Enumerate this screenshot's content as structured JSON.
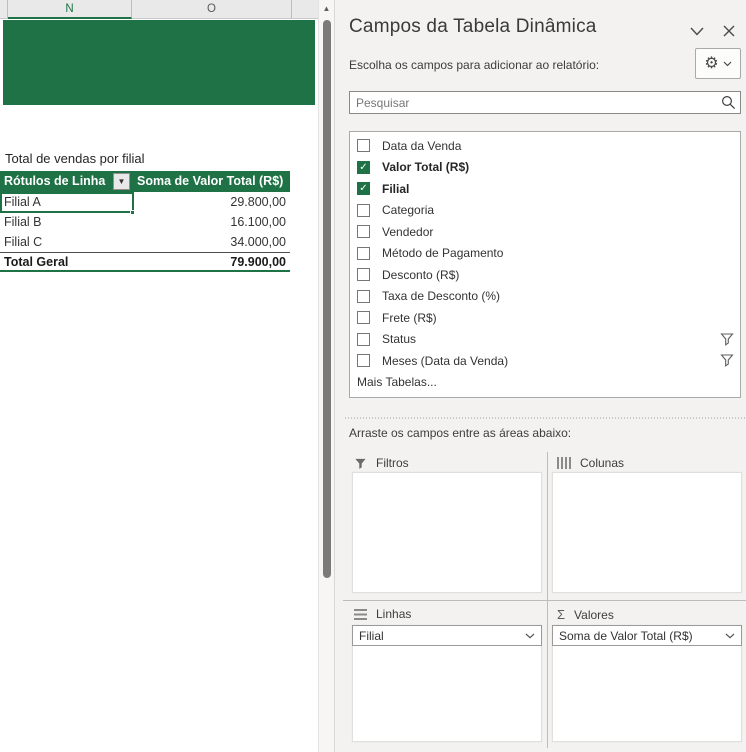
{
  "colors": {
    "accent_green": "#1f7245"
  },
  "spreadsheet": {
    "column_headers": [
      "N",
      "O"
    ],
    "active_column": "N",
    "scrollbar_up_arrow": "▲",
    "pivot": {
      "title": "Total de vendas por filial",
      "header": {
        "col1": "Rótulos de Linha",
        "col2": "Soma de Valor Total (R$)",
        "dropdown_glyph": "▼"
      },
      "rows": [
        {
          "label": "Filial A",
          "value": "29.800,00"
        },
        {
          "label": "Filial B",
          "value": "16.100,00"
        },
        {
          "label": "Filial C",
          "value": "34.000,00"
        }
      ],
      "total": {
        "label": "Total Geral",
        "value": "79.900,00"
      },
      "selected_cell": "Filial A"
    }
  },
  "panel": {
    "title": "Campos da Tabela Dinâmica",
    "subtitle": "Escolha os campos para adicionar ao relatório:",
    "search": {
      "placeholder": "Pesquisar"
    },
    "fields": [
      {
        "label": "Data da Venda",
        "checked": false
      },
      {
        "label": "Valor Total (R$)",
        "checked": true
      },
      {
        "label": "Filial",
        "checked": true
      },
      {
        "label": "Categoria",
        "checked": false
      },
      {
        "label": "Vendedor",
        "checked": false
      },
      {
        "label": "Método de Pagamento",
        "checked": false
      },
      {
        "label": "Desconto (R$)",
        "checked": false
      },
      {
        "label": "Taxa de Desconto (%)",
        "checked": false
      },
      {
        "label": "Frete (R$)",
        "checked": false
      },
      {
        "label": "Status",
        "checked": false,
        "filter": true
      },
      {
        "label": "Meses (Data da Venda)",
        "checked": false,
        "filter": true
      }
    ],
    "more_tables_label": "Mais Tabelas...",
    "drag_hint": "Arraste os campos entre as áreas abaixo:",
    "areas": {
      "filters": {
        "label": "Filtros",
        "items": []
      },
      "columns": {
        "label": "Colunas",
        "items": []
      },
      "rows": {
        "label": "Linhas",
        "items": [
          "Filial"
        ]
      },
      "values": {
        "label": "Valores",
        "items": [
          "Soma de Valor Total (R$)"
        ]
      },
      "values_icon_glyph": "Σ"
    }
  }
}
